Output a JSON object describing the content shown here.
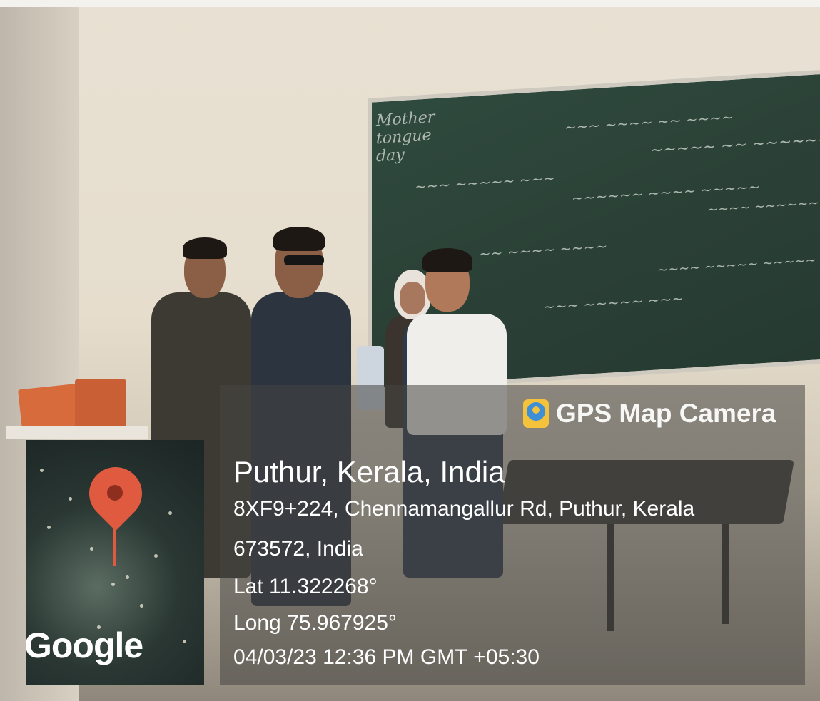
{
  "watermark": {
    "app_name": "GPS Map Camera",
    "location_title": "Puthur, Kerala, India",
    "address_line_1": "8XF9+224, Chennamangallur Rd, Puthur, Kerala",
    "address_line_2": "673572, India",
    "latitude": "Lat 11.322268°",
    "longitude": "Long 75.967925°",
    "timestamp": "04/03/23 12:36 PM GMT +05:30",
    "map_label": "Google",
    "map_pin_icon": "map-pin-icon",
    "app_icon": "gps-map-camera-icon"
  },
  "scene": {
    "board_heading": "Mother tongue day"
  },
  "colors": {
    "pin": "#e05a3f",
    "app_icon": "#f5c33b",
    "blackboard": "#2f4a3e"
  }
}
